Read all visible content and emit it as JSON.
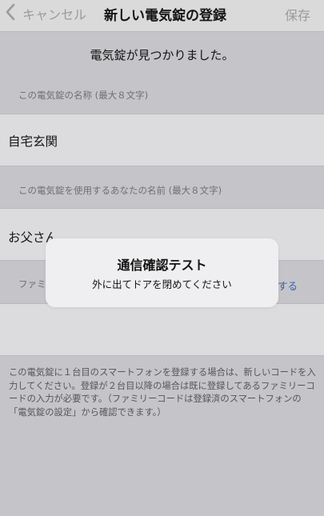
{
  "nav": {
    "back_label": "キャンセル",
    "title": "新しい電気錠の登録",
    "save_label": "保存"
  },
  "found_message": "電気錠が見つかりました。",
  "lock_name": {
    "label": "この電気錠の名称 (最大８文字)",
    "value": "自宅玄関"
  },
  "user_name": {
    "label": "この電気錠を使用するあなたの名前 (最大８文字)",
    "value": "お父さん"
  },
  "family_code": {
    "label_partial": "ファミ",
    "link_partial": "する",
    "value": ""
  },
  "footer_note": "この電気錠に１台目のスマートフォンを登録する場合は、新しいコードを入力してください。登録が２台目以降の場合は既に登録してあるファミリーコードの入力が必要です。（ファミリーコードは登録済のスマートフォンの「電気錠の設定」から確認できます。）",
  "alert": {
    "title": "通信確認テスト",
    "message": "外に出てドアを閉めてください"
  },
  "colors": {
    "background": "#c5c5c9",
    "cell": "#dcdcde",
    "link": "#2f62b5",
    "alert": "#efeff1"
  }
}
